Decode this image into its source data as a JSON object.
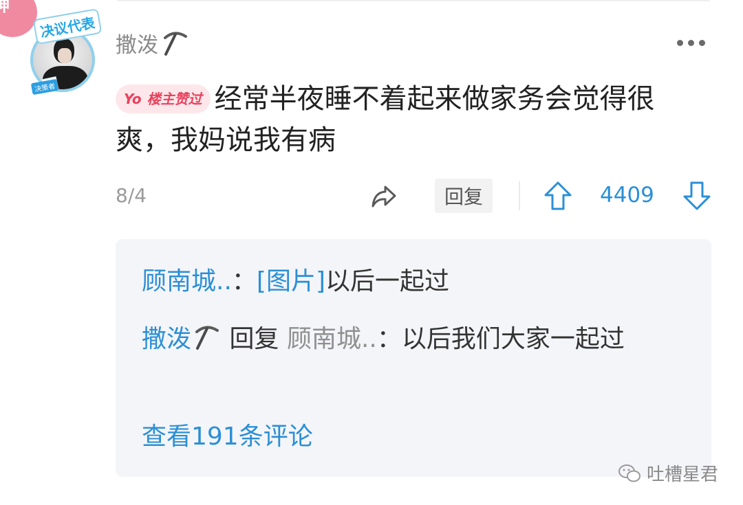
{
  "badge": {
    "text": "神"
  },
  "avatar": {
    "frame_title": "决议代表",
    "frame_tag": "决策者"
  },
  "comment": {
    "username": "撒泼",
    "op_badge": {
      "yo": "Yo",
      "text": "楼主赞过"
    },
    "text": "经常半夜睡不着起来做家务会觉得很爽，我妈说我有病",
    "date": "8/4",
    "reply_button": "回复",
    "vote_count": "4409"
  },
  "replies": {
    "items": [
      {
        "author": "顾南城..",
        "separator": "：",
        "image_tag": "[图片]",
        "text": "以后一起过"
      },
      {
        "author": "撒泼",
        "reply_word": "回复",
        "target": "顾南城..",
        "separator": "：",
        "text": "以后我们大家一起过"
      }
    ],
    "view_more": "查看191条评论"
  },
  "watermark": {
    "text": "吐槽星君"
  },
  "colors": {
    "accent": "#2b8fd5",
    "op_badge": "#e8425e",
    "god_badge": "#f08aa0"
  },
  "icons": [
    "pickaxe-icon",
    "more-icon",
    "share-icon",
    "upvote-icon",
    "downvote-icon",
    "wechat-icon"
  ]
}
